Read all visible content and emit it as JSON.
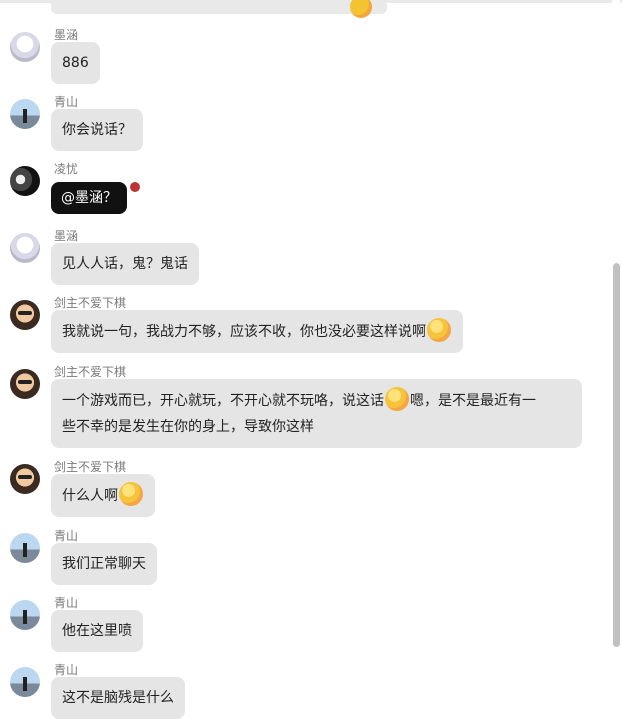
{
  "messages": [
    {
      "name": "墨涵",
      "text": "886",
      "avatar": "anime-white-hair-avatar"
    },
    {
      "name": "青山",
      "text": "你会说话？",
      "avatar": "landscape-person-avatar"
    },
    {
      "name": "凌忧",
      "text": "@墨涵？",
      "avatar": "dark-anime-avatar"
    },
    {
      "name": "墨涵",
      "text": "见人人话，鬼？鬼话",
      "avatar": "anime-white-hair-avatar"
    },
    {
      "name": "剑主不爱下棋",
      "text_pre": "我就说一句，我战力不够，应该不收，你也没必要这样说啊",
      "emoji": "blushing-face-icon",
      "avatar": "sunglasses-face-avatar"
    },
    {
      "name": "剑主不爱下棋",
      "line1_pre": "一个游戏而已，开心就玩，不开心就不玩咯，说这话",
      "line1_post": "嗯，是不是最近有一",
      "line2": "些不幸的是发生在你的身上，导致你这样",
      "avatar": "sunglasses-face-avatar"
    },
    {
      "name": "剑主不爱下棋",
      "text_pre": "什么人啊",
      "avatar": "sunglasses-face-avatar"
    },
    {
      "name": "青山",
      "text": "我们正常聊天",
      "avatar": "landscape-person-avatar"
    },
    {
      "name": "青山",
      "text": "他在这里喷",
      "avatar": "landscape-person-avatar"
    },
    {
      "name": "青山",
      "text": "这不是脑残是什么",
      "avatar": "landscape-person-avatar"
    }
  ],
  "colors": {
    "bubble": "#e5e5e5",
    "dark_bubble": "#111111",
    "name_text": "#7a7a7a"
  }
}
